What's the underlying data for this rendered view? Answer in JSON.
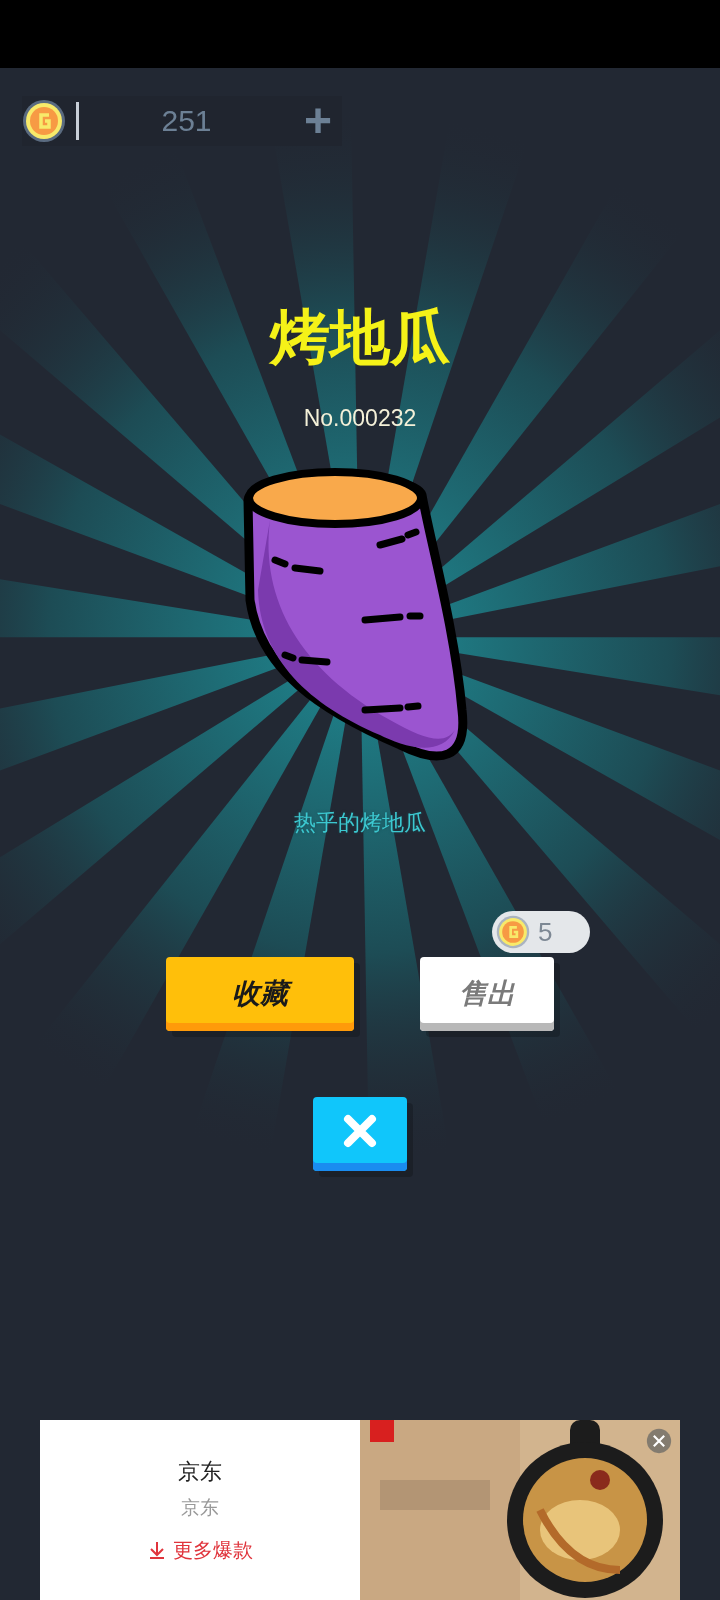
{
  "coins": {
    "amount": "251",
    "add": "+"
  },
  "item": {
    "name": "烤地瓜",
    "number": "No.000232",
    "description": "热乎的烤地瓜"
  },
  "actions": {
    "collect": "收藏",
    "sell": "售出",
    "sell_price": "5"
  },
  "ad": {
    "brand": "京东",
    "advertiser": "京东",
    "link": "更多爆款"
  }
}
